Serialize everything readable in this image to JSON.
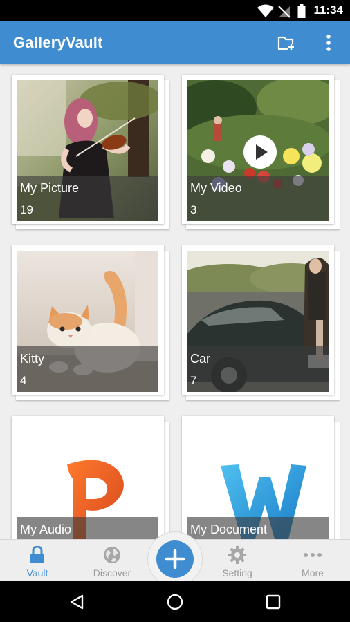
{
  "status_bar": {
    "time": "11:34",
    "icons": [
      "wifi-icon",
      "no-signal-icon",
      "battery-icon"
    ]
  },
  "app_bar": {
    "title": "GalleryVault",
    "actions": [
      "new-folder-icon",
      "overflow-menu-icon"
    ]
  },
  "folders": [
    {
      "name": "My Picture",
      "count": "19",
      "thumbnail": "girl-playing-violin-photo"
    },
    {
      "name": "My Video",
      "count": "3",
      "thumbnail": "garden-photo",
      "badge": "play-icon"
    },
    {
      "name": "Kitty",
      "count": "4",
      "thumbnail": "kitten-photo"
    },
    {
      "name": "Car",
      "count": "7",
      "thumbnail": "classic-car-photo"
    },
    {
      "name": "My Audio",
      "count": "",
      "thumbnail": "orange-p-logo"
    },
    {
      "name": "My Document",
      "count": "",
      "thumbnail": "blue-w-logo"
    }
  ],
  "bottom_nav": {
    "items": [
      {
        "label": "Vault",
        "icon": "lock-icon",
        "active": true
      },
      {
        "label": "Discover",
        "icon": "globe-icon",
        "active": false
      },
      {
        "label": "Setting",
        "icon": "gear-icon",
        "active": false
      },
      {
        "label": "More",
        "icon": "more-dots-icon",
        "active": false
      }
    ],
    "fab_icon": "plus-icon"
  },
  "system_nav": [
    "back-icon",
    "home-icon",
    "recents-icon"
  ],
  "colors": {
    "primary": "#3f8dd0",
    "background": "#efefef",
    "inactive": "#9a9a9a"
  }
}
